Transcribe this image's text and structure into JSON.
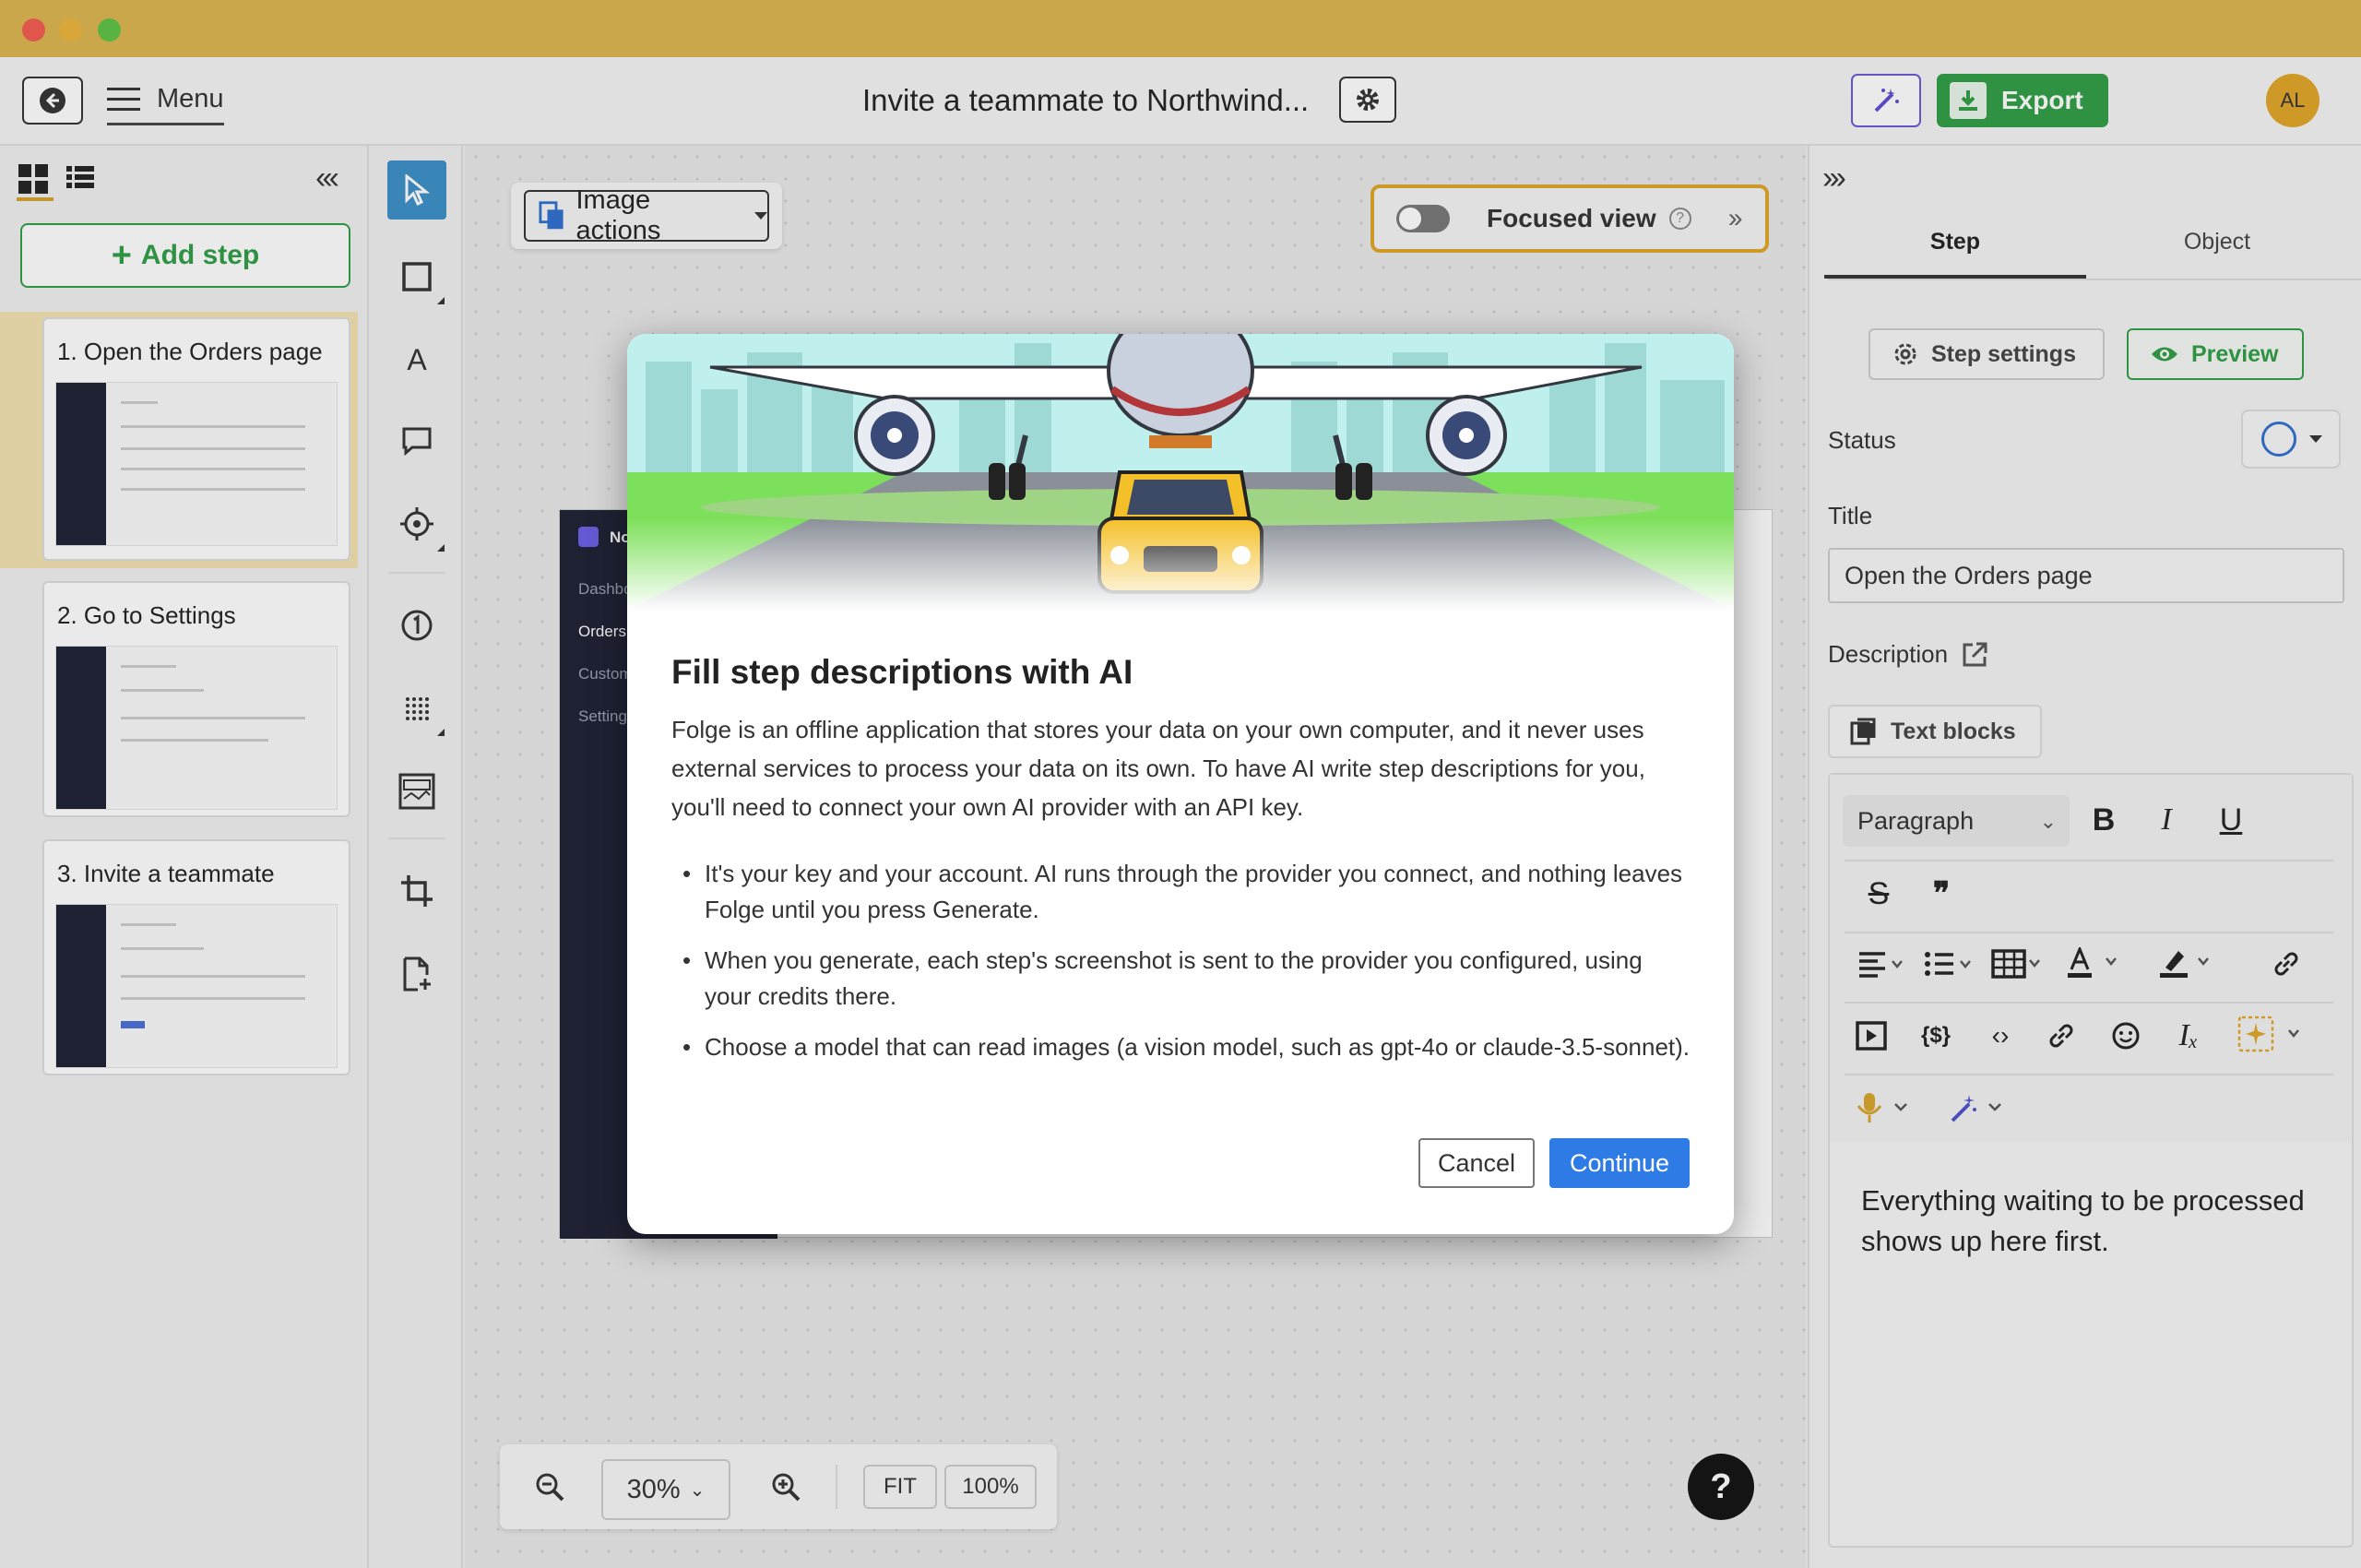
{
  "header": {
    "menu_label": "Menu",
    "document_title": "Invite a teammate to Northwind...",
    "export_label": "Export",
    "avatar_initials": "AL"
  },
  "left_panel": {
    "add_step_label": "Add step",
    "steps": [
      {
        "title": "1. Open the Orders page"
      },
      {
        "title": "2. Go to Settings"
      },
      {
        "title": "3. Invite a teammate"
      }
    ]
  },
  "canvas": {
    "image_actions_label": "Image actions",
    "focused_view_label": "Focused view",
    "focused_view_on": false,
    "bg_sidebar_items": [
      "No",
      "Dashbo",
      "Orders",
      "Custom",
      "Setting"
    ],
    "zoom": {
      "percent_label": "30%",
      "fit_label": "FIT",
      "full_label": "100%"
    },
    "help_label": "?"
  },
  "right_panel": {
    "tabs": [
      {
        "label": "Step"
      },
      {
        "label": "Object"
      }
    ],
    "step_settings_label": "Step settings",
    "preview_label": "Preview",
    "status_label": "Status",
    "title_label": "Title",
    "title_value": "Open the Orders page",
    "description_label": "Description",
    "text_blocks_label": "Text blocks",
    "paragraph_style": "Paragraph",
    "editor_text": "Everything waiting to be processed shows up here first."
  },
  "modal": {
    "title": "Fill step descriptions with AI",
    "description": "Folge is an offline application that stores your data on your own computer, and it never uses external services to process your data on its own. To have AI write step descriptions for you, you'll need to connect your own AI provider with an API key.",
    "bullets": [
      "It's your key and your account. AI runs through the provider you connect, and nothing leaves Folge until you press Generate.",
      "When you generate, each step's screenshot is sent to the provider you configured, using your credits there.",
      "Choose a model that can read images (a vision model, such as gpt-4o or claude-3.5-sonnet)."
    ],
    "cancel_label": "Cancel",
    "continue_label": "Continue"
  },
  "colors": {
    "titlebar": "#c9a74a",
    "accent_green": "#2f9e44",
    "accent_blue": "#2f7be6",
    "highlight_gold": "#e0a526"
  }
}
